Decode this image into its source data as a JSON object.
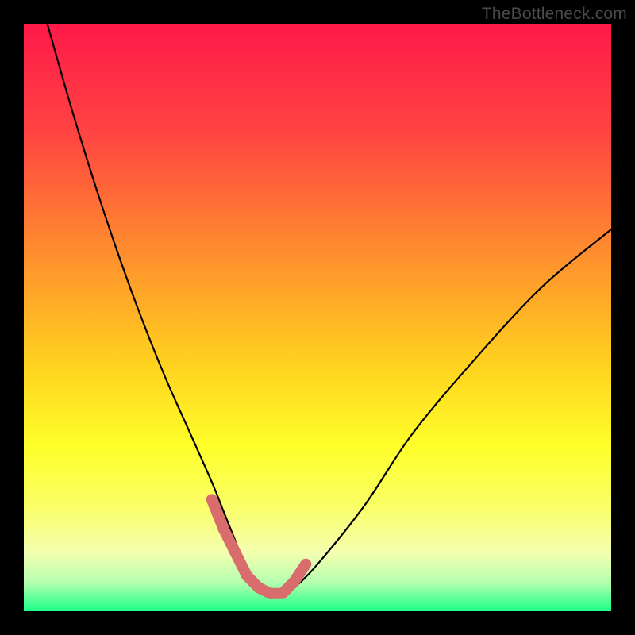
{
  "watermark": "TheBottleneck.com",
  "chart_data": {
    "type": "line",
    "title": "",
    "xlabel": "",
    "ylabel": "",
    "xlim": [
      0,
      100
    ],
    "ylim": [
      0,
      100
    ],
    "gradient_stops": [
      {
        "offset": 0,
        "color": "#ff1a49"
      },
      {
        "offset": 0.18,
        "color": "#ff4242"
      },
      {
        "offset": 0.38,
        "color": "#ff8a2f"
      },
      {
        "offset": 0.58,
        "color": "#ffd21f"
      },
      {
        "offset": 0.72,
        "color": "#ffff2a"
      },
      {
        "offset": 0.82,
        "color": "#faff66"
      },
      {
        "offset": 0.9,
        "color": "#f4ffb0"
      },
      {
        "offset": 0.95,
        "color": "#b8ffb0"
      },
      {
        "offset": 1.0,
        "color": "#1bff88"
      }
    ],
    "series": [
      {
        "name": "bottleneck-curve",
        "x": [
          4,
          8,
          12,
          16,
          20,
          24,
          28,
          32,
          34,
          36,
          38,
          40,
          42,
          44,
          46,
          50,
          58,
          66,
          76,
          88,
          100
        ],
        "y": [
          100,
          86,
          73,
          61,
          50,
          40,
          31,
          22,
          17,
          12,
          7,
          4,
          3,
          3,
          4,
          8,
          18,
          30,
          42,
          55,
          65
        ]
      }
    ],
    "marker_region": {
      "name": "optimal-zone",
      "color": "#d96c6c",
      "points_x": [
        32,
        34,
        36,
        38,
        40,
        42,
        44,
        46,
        48
      ],
      "points_y": [
        19,
        14,
        10,
        6,
        4,
        3,
        3,
        5,
        8
      ]
    }
  }
}
